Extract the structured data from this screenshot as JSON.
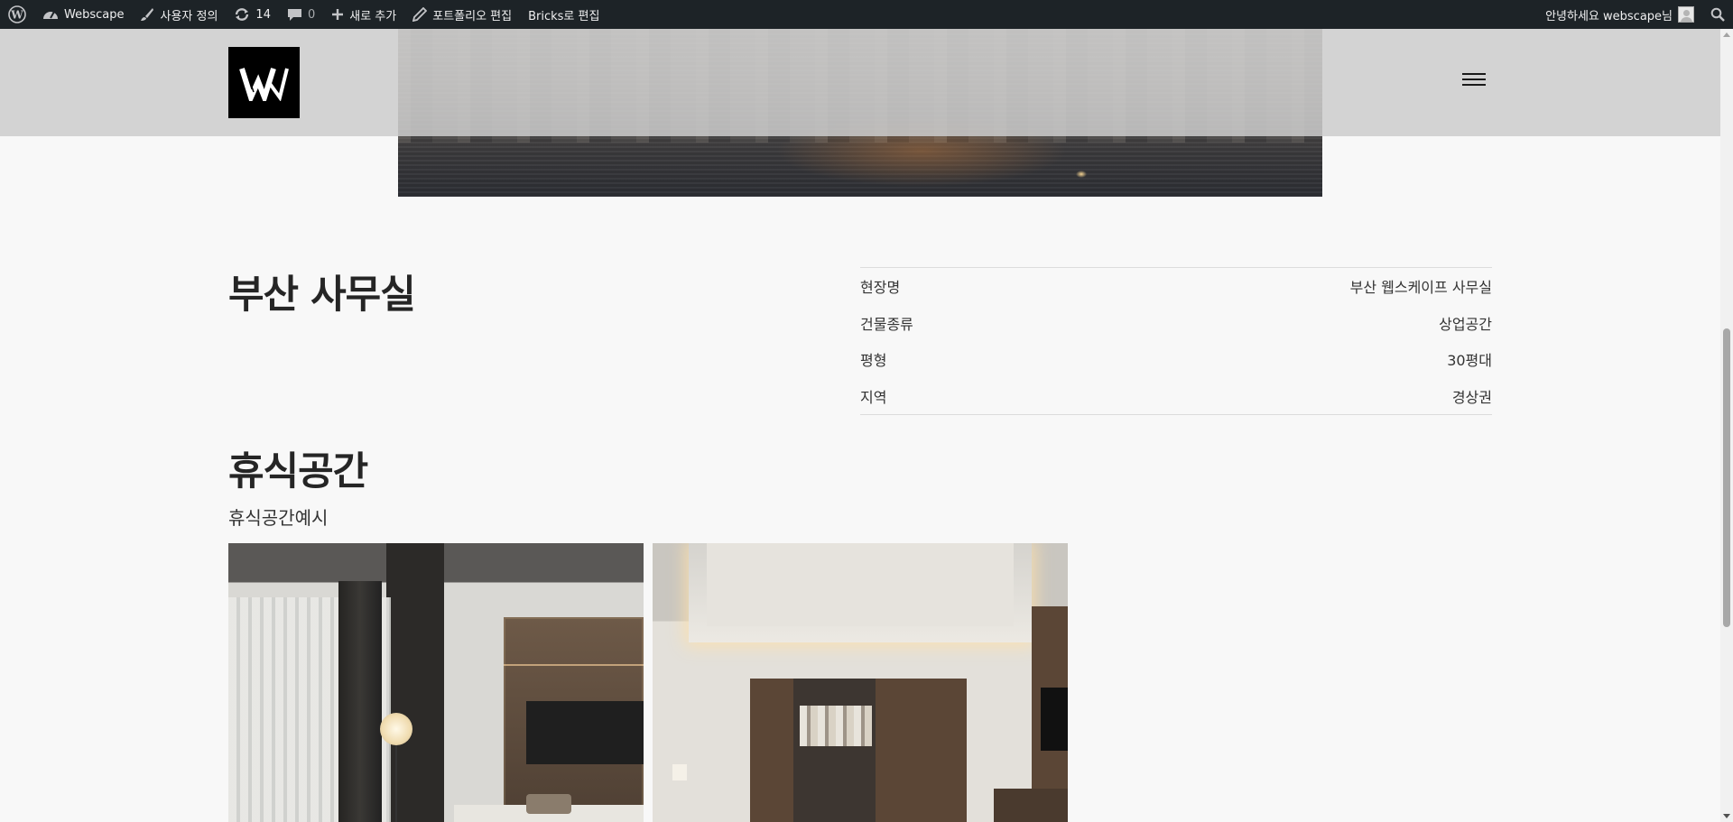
{
  "adminbar": {
    "wp_logo_icon": "wordpress-icon",
    "site_name": "Webscape",
    "customize_label": "사용자 정의",
    "updates_count": "14",
    "comments_count": "0",
    "new_label": "새로 추가",
    "edit_portfolio_label": "포트폴리오 편집",
    "bricks_label": "Bricks로 편집",
    "greeting": "안녕하세요 webscape님"
  },
  "header": {
    "logo_letter": "W"
  },
  "project": {
    "title": "부산 사무실",
    "info": [
      {
        "label": "현장명",
        "value": "부산 웹스케이프 사무실"
      },
      {
        "label": "건물종류",
        "value": "상업공간"
      },
      {
        "label": "평형",
        "value": "30평대"
      },
      {
        "label": "지역",
        "value": "경상권"
      }
    ]
  },
  "section": {
    "title": "휴식공간",
    "subtitle": "휴식공간예시"
  },
  "colors": {
    "adminbar_bg": "#1d2327",
    "page_bg": "#f8f8f8",
    "header_bg": "#cdcdcd"
  }
}
